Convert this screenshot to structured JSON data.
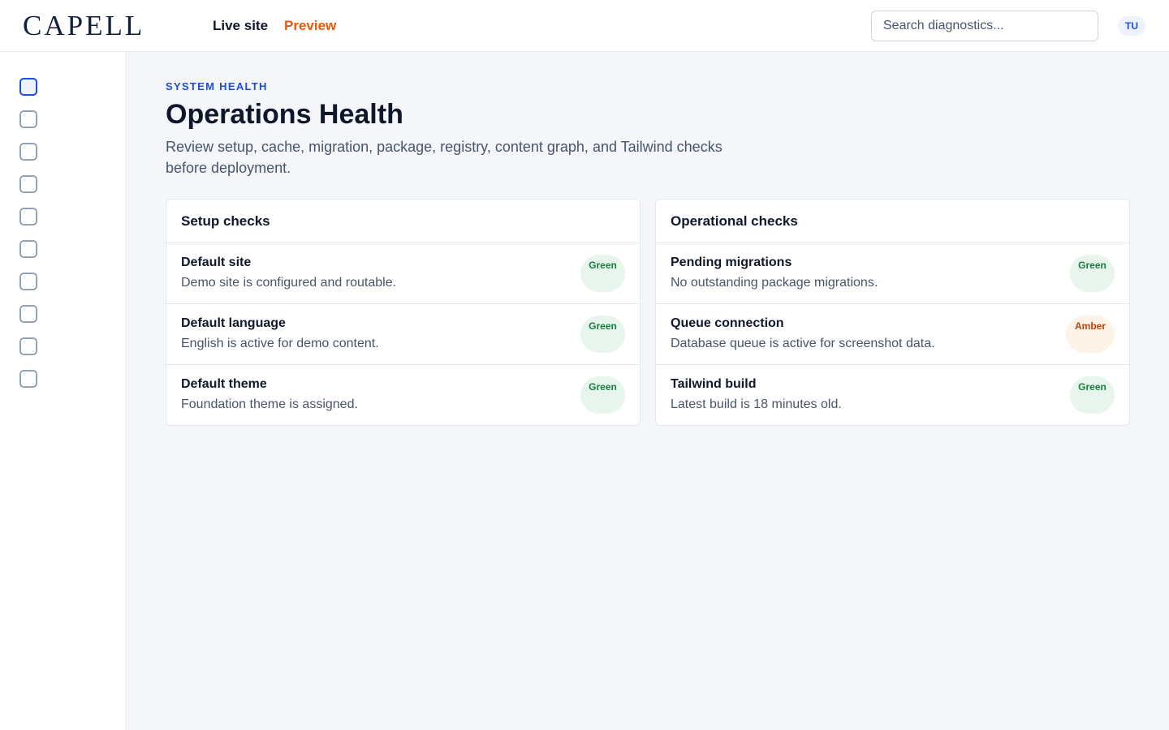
{
  "app": {
    "logo": "CAPELL"
  },
  "nav": {
    "live": "Live site",
    "preview": "Preview"
  },
  "search": {
    "placeholder": "Search diagnostics..."
  },
  "user": {
    "initials": "TU"
  },
  "page": {
    "eyebrow": "SYSTEM HEALTH",
    "title": "Operations Health",
    "subtitle": "Review setup, cache, migration, package, registry, content graph, and Tailwind checks before deployment."
  },
  "setup": {
    "title": "Setup checks",
    "rows": [
      {
        "title": "Default site",
        "desc": "Demo site is configured and routable.",
        "status": "Green"
      },
      {
        "title": "Default language",
        "desc": "English is active for demo content.",
        "status": "Green"
      },
      {
        "title": "Default theme",
        "desc": "Foundation theme is assigned.",
        "status": "Green"
      }
    ]
  },
  "operational": {
    "title": "Operational checks",
    "rows": [
      {
        "title": "Pending migrations",
        "desc": "No outstanding package migrations.",
        "status": "Green"
      },
      {
        "title": "Queue connection",
        "desc": "Database queue is active for screenshot data.",
        "status": "Amber"
      },
      {
        "title": "Tailwind build",
        "desc": "Latest build is 18 minutes old.",
        "status": "Green"
      }
    ]
  },
  "colors": {
    "accent": "#1d4ed8",
    "preview": "#ea580c",
    "green": "#15803d",
    "amber": "#c2410c"
  }
}
